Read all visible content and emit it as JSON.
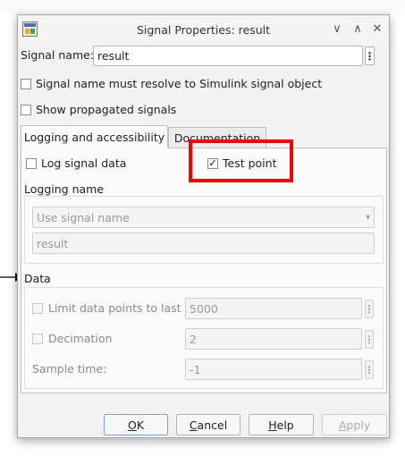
{
  "window": {
    "title": "Signal Properties: result"
  },
  "signal": {
    "name_label": "Signal name:",
    "name_value": "result"
  },
  "options": {
    "resolve_label": "Signal name must resolve to Simulink signal object",
    "propagated_label": "Show propagated signals"
  },
  "tabs": [
    {
      "label": "Logging and accessibility",
      "active": true
    },
    {
      "label": "Documentation",
      "active": false
    }
  ],
  "logging": {
    "log_signal_label": "Log signal data",
    "test_point_label": "Test point",
    "test_point_checked": "✓",
    "logging_name_header": "Logging name",
    "name_mode_value": "Use signal name",
    "name_value": "result"
  },
  "data_section": {
    "header": "Data",
    "limit_label": "Limit data points to last",
    "limit_value": "5000",
    "decimation_label": "Decimation",
    "decimation_value": "2",
    "sample_time_label": "Sample time:",
    "sample_time_value": "-1"
  },
  "buttons": {
    "ok": {
      "mnemonic": "O",
      "rest": "K"
    },
    "cancel": {
      "mnemonic": "C",
      "rest": "ancel"
    },
    "help": {
      "mnemonic": "H",
      "rest": "elp"
    },
    "apply": {
      "mnemonic": "A",
      "rest": "pply"
    }
  },
  "icons": {
    "dots": "⋮",
    "dropdown": "▾",
    "minimize": "∨",
    "maximize": "∧",
    "close": "✕"
  },
  "colors": {
    "highlight": "#ff0000",
    "default_button_border": "#7aa2d6"
  }
}
